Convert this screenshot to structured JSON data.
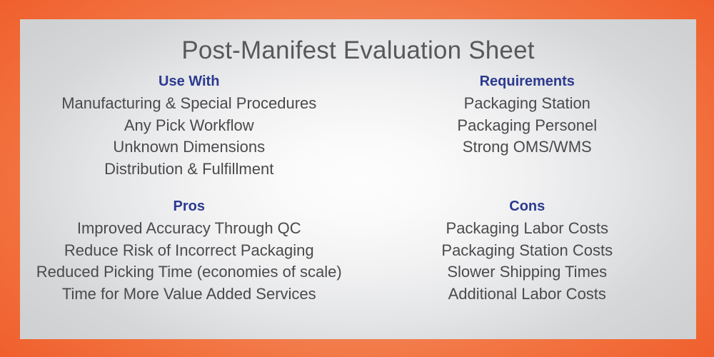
{
  "slide": {
    "title": "Post-Manifest Evaluation Sheet",
    "border_color": "#ef5a28",
    "border_color_light": "#f4976c",
    "panel_color_center": "#fcfcfc",
    "panel_color_edge": "#d1d2d4",
    "heading_color": "#2b3a8f",
    "body_color": "#4a4a4c",
    "title_color": "#58585b"
  },
  "sections": [
    {
      "heading": "Use With",
      "items": [
        "Manufacturing & Special Procedures",
        "Any Pick Workflow",
        "Unknown Dimensions",
        "Distribution & Fulfillment"
      ]
    },
    {
      "heading": "Requirements",
      "items": [
        "Packaging Station",
        "Packaging Personel",
        "Strong OMS/WMS"
      ]
    },
    {
      "heading": "Pros",
      "items": [
        "Improved Accuracy Through QC",
        "Reduce Risk of Incorrect Packaging",
        "Reduced Picking Time (economies of scale)",
        "Time for More Value Added Services"
      ]
    },
    {
      "heading": "Cons",
      "items": [
        "Packaging Labor Costs",
        "Packaging Station Costs",
        "Slower Shipping Times",
        "Additional Labor Costs"
      ]
    }
  ]
}
